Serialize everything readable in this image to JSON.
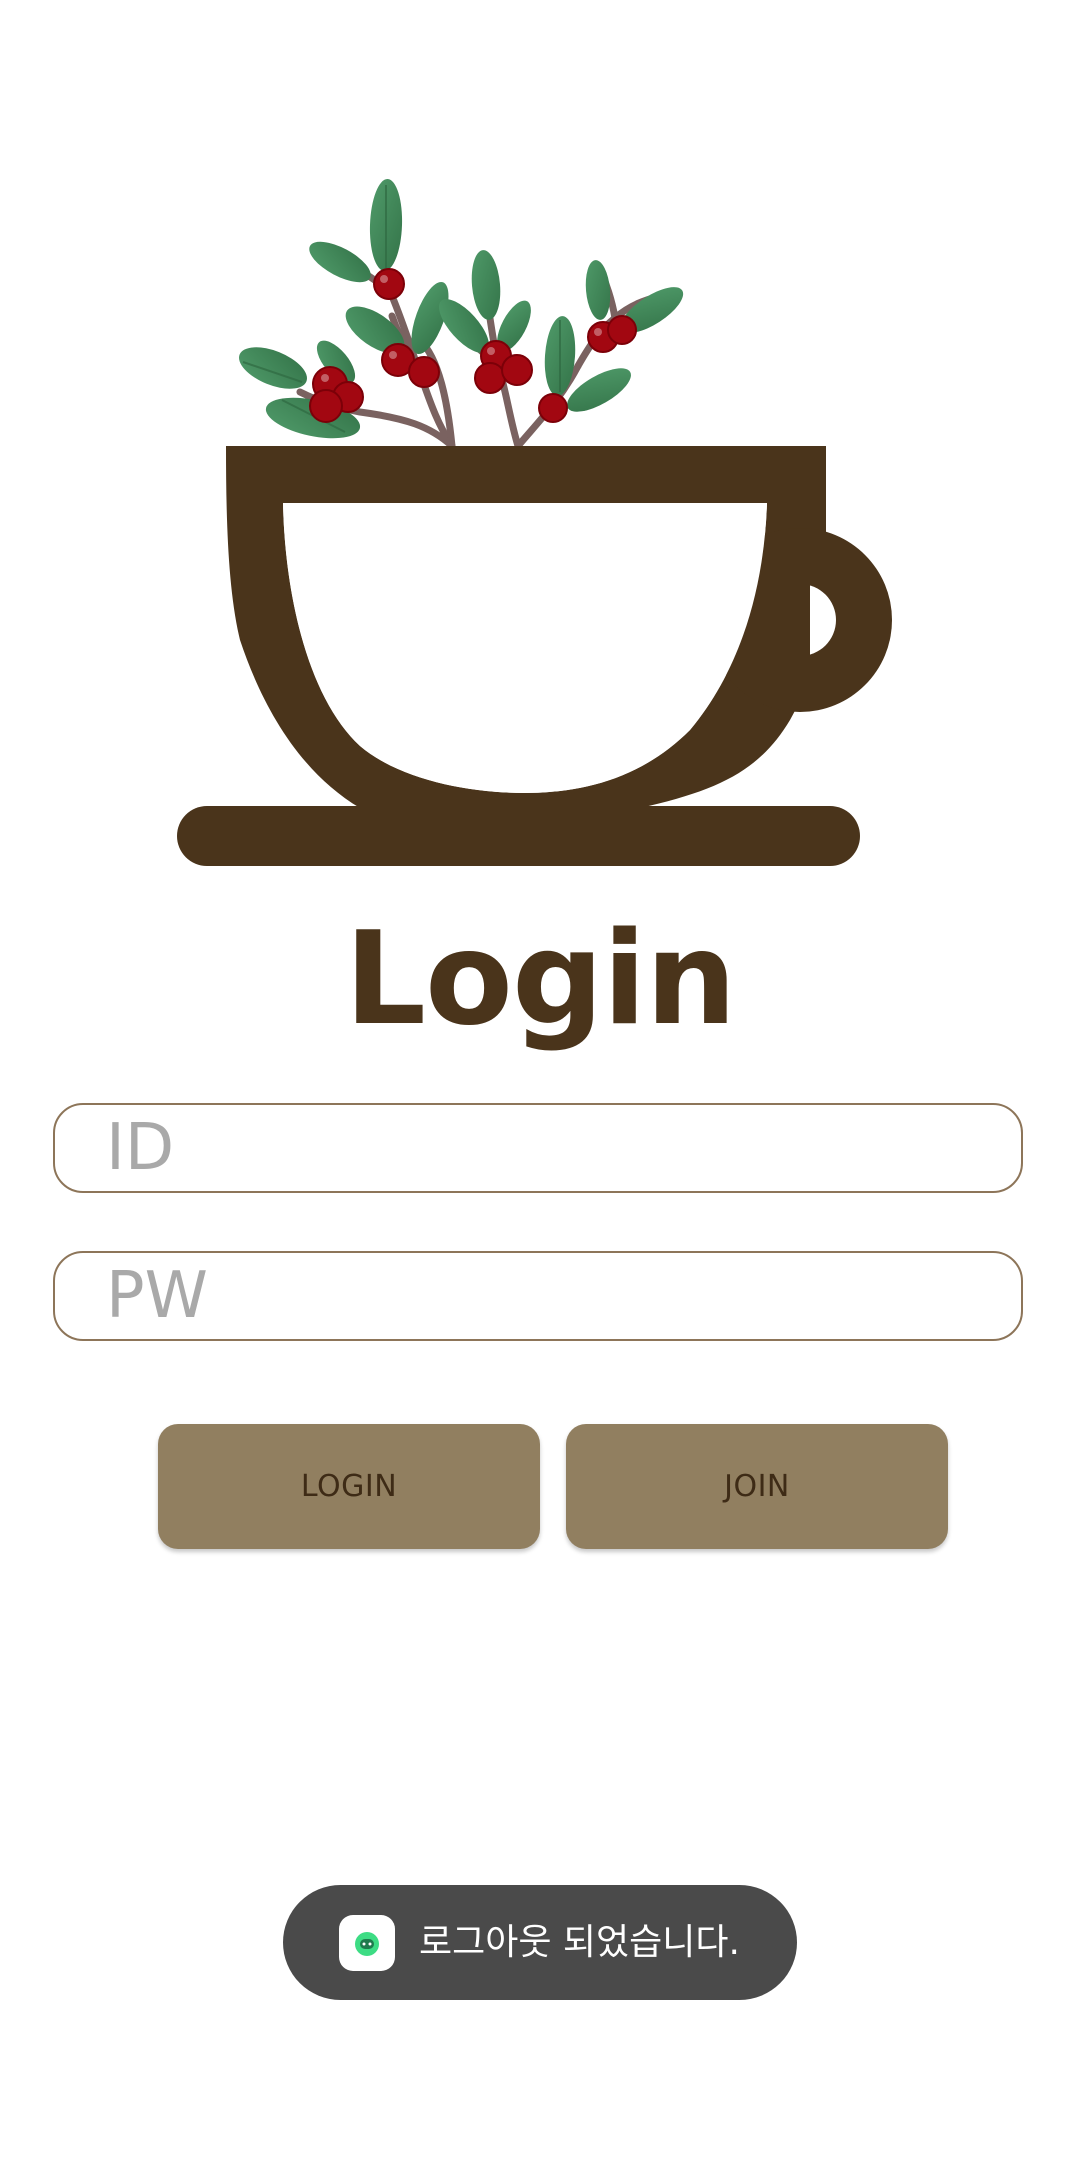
{
  "screen": {
    "title": "Login"
  },
  "form": {
    "id_placeholder": "ID",
    "id_value": "",
    "pw_placeholder": "PW",
    "pw_value": ""
  },
  "buttons": {
    "login_label": "LOGIN",
    "join_label": "JOIN"
  },
  "toast": {
    "message": "로그아웃 되었습니다.",
    "icon": "android-app-icon"
  },
  "colors": {
    "brand_brown": "#4a341b",
    "button_fill": "#917f60",
    "field_border": "#8d7559",
    "leaf_green": "#428a5b",
    "berry_red": "#a00610"
  }
}
